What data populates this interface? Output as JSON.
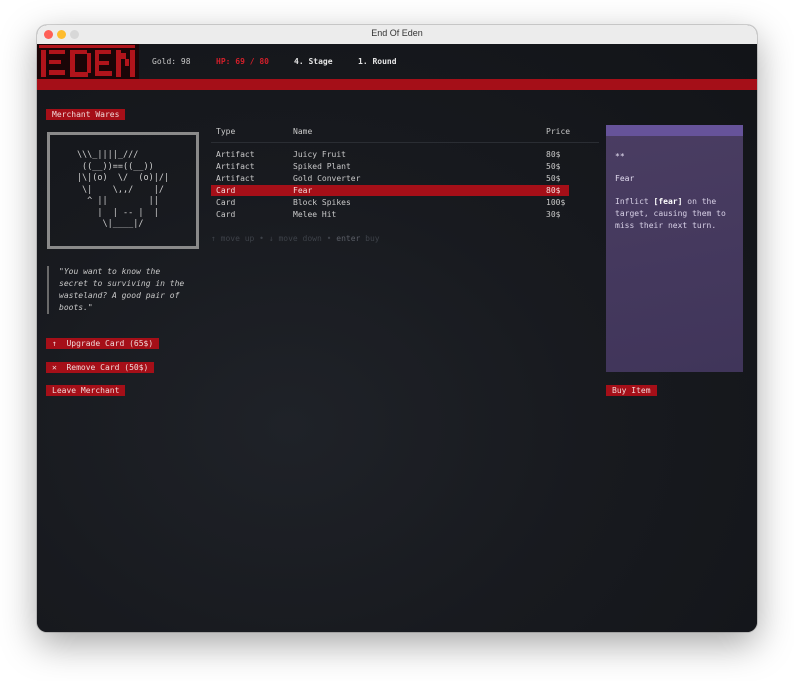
{
  "window": {
    "title": "End Of Eden"
  },
  "header": {
    "logo_text": "EDEN",
    "gold": "Gold: 98",
    "hp": "HP: 69 / 80",
    "stage": "4. Stage",
    "round": "1. Round",
    "colors": {
      "accent_red": "#a50f18",
      "hp_red": "#d21f2a"
    }
  },
  "left": {
    "section_label": "Merchant Wares",
    "ascii_art": "\\\\\\_||||_///\n ((__))==((__))\n|\\|(o)  \\/  (o)|/|\n \\|    \\,,/    |/\n  ^ ||        ||\n    |  | -- |  |\n     \\|____|/",
    "quote": "\"You want to know the secret to surviving in the wasteland? A good pair of boots.\"",
    "actions": [
      {
        "icon": "↑",
        "label": "Upgrade Card (65$)"
      },
      {
        "icon": "✕",
        "label": "Remove Card (50$)"
      }
    ],
    "leave_label": "Leave Merchant"
  },
  "table": {
    "headers": {
      "type": "Type",
      "name": "Name",
      "price": "Price"
    },
    "rows": [
      {
        "type": "Artifact",
        "name": "Juicy Fruit",
        "price": "80$"
      },
      {
        "type": "Artifact",
        "name": "Spiked Plant",
        "price": "50$"
      },
      {
        "type": "Artifact",
        "name": "Gold Converter",
        "price": "50$"
      },
      {
        "type": "Card",
        "name": "Fear",
        "price": "80$"
      },
      {
        "type": "Card",
        "name": "Block Spikes",
        "price": "100$"
      },
      {
        "type": "Card",
        "name": "Melee Hit",
        "price": "30$"
      }
    ],
    "selected_index": 3,
    "hint": {
      "up": "↑ move up",
      "sep1": " • ",
      "down": "↓ move down",
      "sep2": " • ",
      "enter_key": "enter",
      "enter_action": " buy"
    }
  },
  "detail": {
    "cost_stars": "**",
    "title": "Fear",
    "desc_pre": "Inflict ",
    "desc_kw": "[fear]",
    "desc_post": " on the target, causing them to miss their next turn.",
    "accent_color": "#66539a"
  },
  "buy_label": "Buy Item"
}
